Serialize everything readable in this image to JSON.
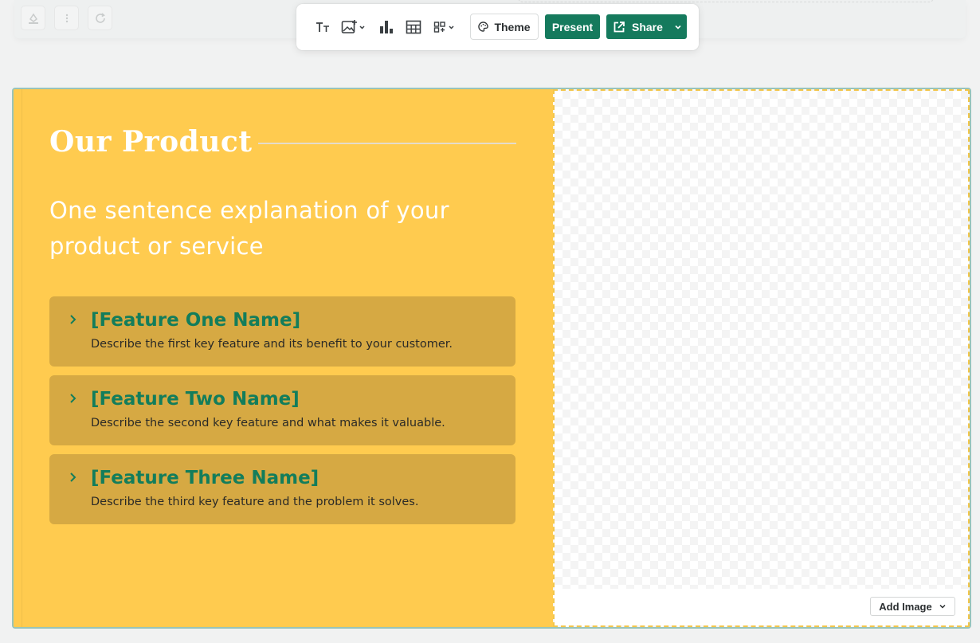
{
  "toolbar": {
    "icons": [
      "text-format-icon",
      "add-image-icon",
      "bar-chart-icon",
      "table-icon",
      "layout-grid-icon"
    ],
    "theme_label": "Theme",
    "present_label": "Present",
    "share_label": "Share"
  },
  "ghost_controls": [
    "fill-icon",
    "more-vertical-icon",
    "refresh-icon"
  ],
  "slide": {
    "title": "Our Product",
    "subtitle": "One sentence explanation of your product or service",
    "features": [
      {
        "name": "[Feature One Name]",
        "description": "Describe the first key feature and its benefit to your customer."
      },
      {
        "name": "[Feature Two Name]",
        "description": "Describe the second key feature and what makes it valuable."
      },
      {
        "name": "[Feature Three Name]",
        "description": "Describe the third key feature and the problem it solves."
      }
    ],
    "add_image_label": "Add Image"
  },
  "colors": {
    "accent_green": "#157a5d",
    "slide_yellow": "#ffcb4f",
    "feature_bg": "#d6a943",
    "feature_title": "#137d5b"
  }
}
